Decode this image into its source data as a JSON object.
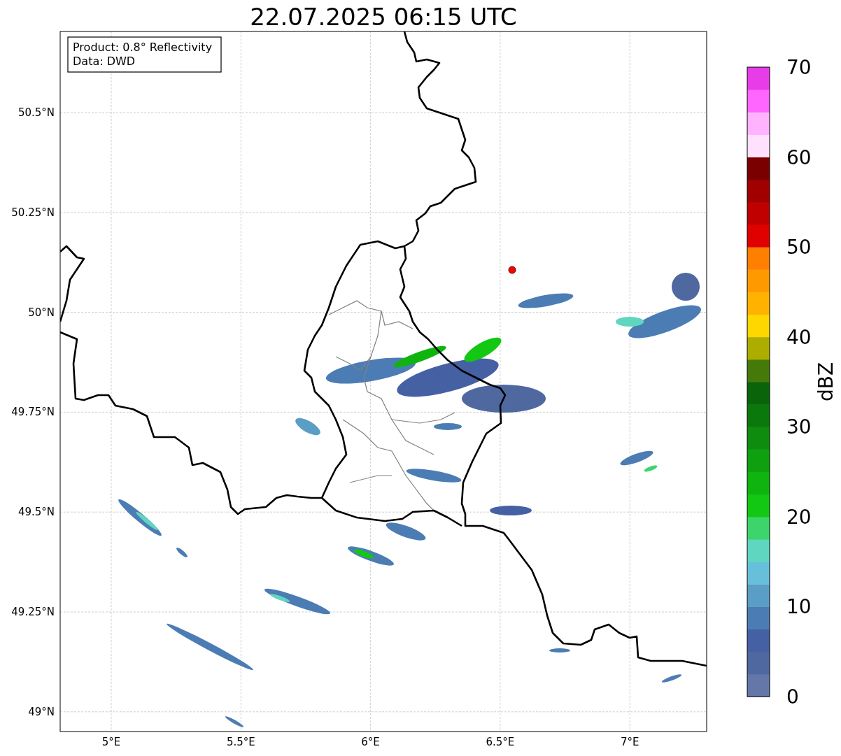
{
  "title": "22.07.2025 06:15 UTC",
  "info_box": {
    "lines": [
      "Product: 0.8° Reflectivity",
      "Data: DWD"
    ]
  },
  "map": {
    "lat_ticks": [
      "50.5°N",
      "50.25°N",
      "50°N",
      "49.75°N",
      "49.5°N",
      "49.25°N",
      "49°N"
    ],
    "lon_ticks": [
      "5°E",
      "5.5°E",
      "6°E",
      "6.5°E",
      "7°E"
    ]
  },
  "colorbar": {
    "label": "dBZ",
    "ticks": [
      "70",
      "60",
      "50",
      "40",
      "30",
      "20",
      "10",
      "0"
    ],
    "bands": [
      {
        "color": "#6477a8"
      },
      {
        "color": "#5068a0"
      },
      {
        "color": "#4660a4"
      },
      {
        "color": "#4c7cb4"
      },
      {
        "color": "#5a9ec6"
      },
      {
        "color": "#66c0dc"
      },
      {
        "color": "#5fd6c0"
      },
      {
        "color": "#3dd46b"
      },
      {
        "color": "#12c812"
      },
      {
        "color": "#0fb40f"
      },
      {
        "color": "#0fa00f"
      },
      {
        "color": "#0d8c0d"
      },
      {
        "color": "#0a780a"
      },
      {
        "color": "#0a640a"
      },
      {
        "color": "#457a0a"
      },
      {
        "color": "#adad00"
      },
      {
        "color": "#ffd700"
      },
      {
        "color": "#ffb300"
      },
      {
        "color": "#ff9900"
      },
      {
        "color": "#ff7f00"
      },
      {
        "color": "#e00000"
      },
      {
        "color": "#c00000"
      },
      {
        "color": "#a00000"
      },
      {
        "color": "#7a0000"
      },
      {
        "color": "#ffe0ff"
      },
      {
        "color": "#ffb3ff"
      },
      {
        "color": "#ff66ff"
      },
      {
        "color": "#e83ce8"
      }
    ]
  }
}
